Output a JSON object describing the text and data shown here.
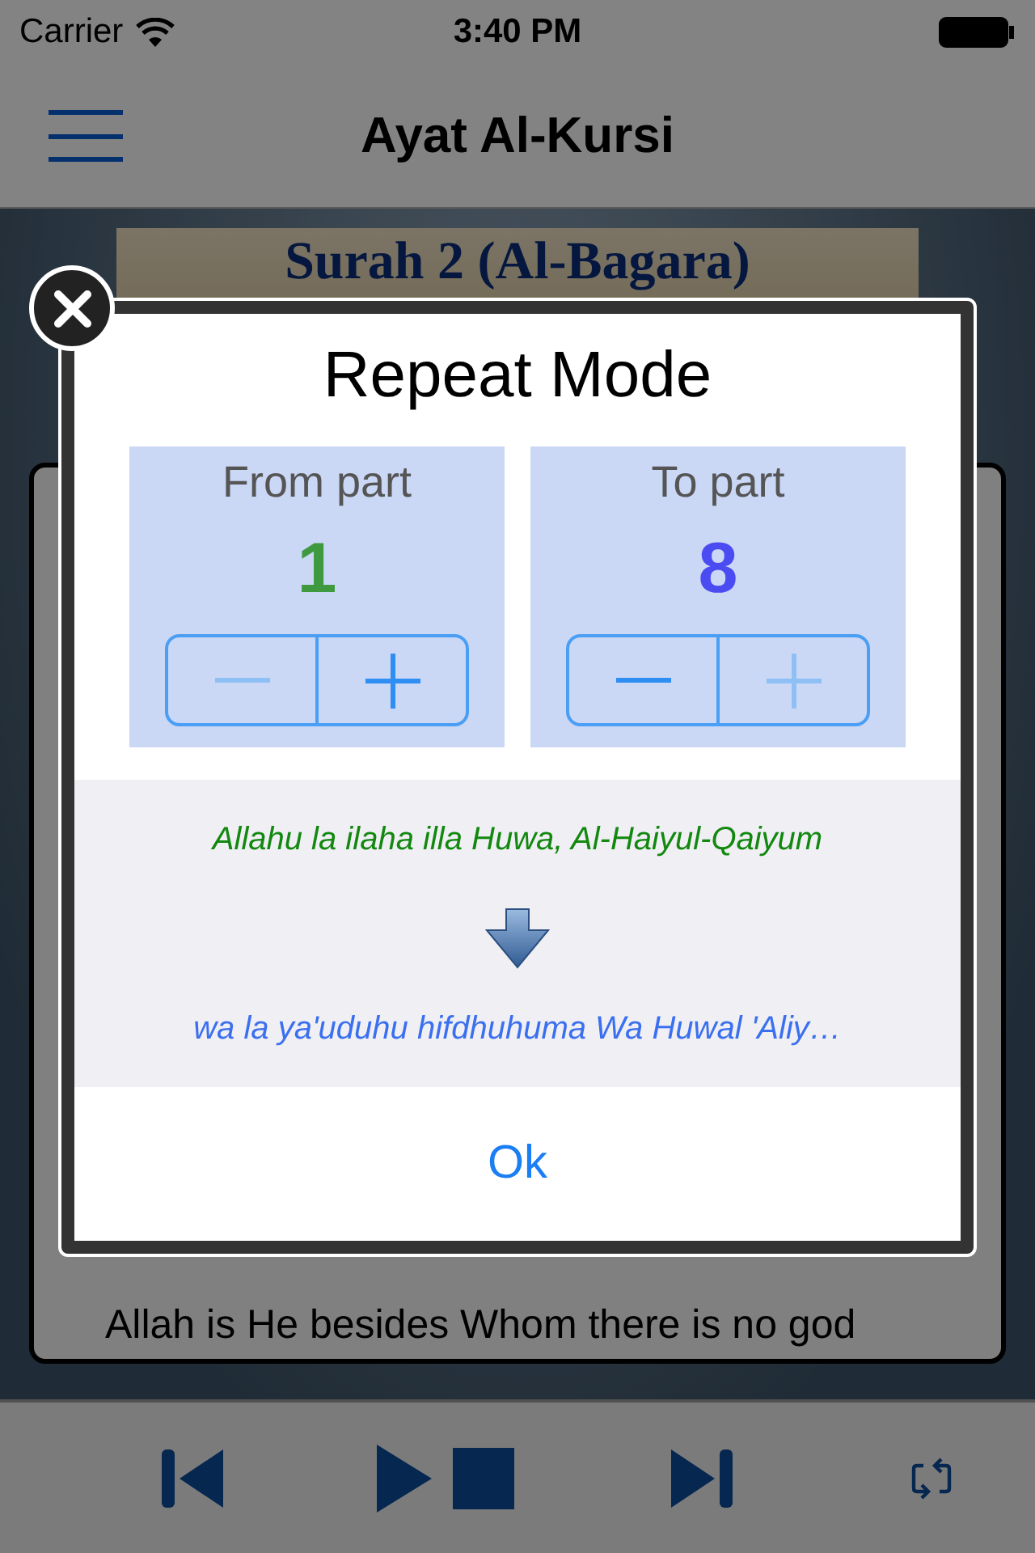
{
  "status_bar": {
    "carrier": "Carrier",
    "time": "3:40 PM"
  },
  "nav_bar": {
    "title": "Ayat Al-Kursi"
  },
  "banner": {
    "title": "Surah 2 (Al-Bagara)"
  },
  "verse_card": {
    "translation": "Allah is He besides Whom there is no god"
  },
  "player": {
    "buttons": [
      {
        "kind": "previous"
      },
      {
        "kind": "play"
      },
      {
        "kind": "stop"
      },
      {
        "kind": "next"
      },
      {
        "kind": "repeat"
      }
    ]
  },
  "dialog": {
    "title": "Repeat Mode",
    "pickers": [
      {
        "label": "From part",
        "value": "1",
        "color": "#3f9a3f",
        "decrement_disabled": true,
        "increment_disabled": false
      },
      {
        "label": "To part",
        "value": "8",
        "color": "#4b4bf2",
        "decrement_disabled": false,
        "increment_disabled": true
      }
    ],
    "from_verse": "Allahu la ilaha illa Huwa, Al-Haiyul-Qaiyum",
    "to_verse": "wa la ya'uduhu hifdhuhuma Wa Huwal 'Aliy…",
    "confirm": "Ok"
  }
}
